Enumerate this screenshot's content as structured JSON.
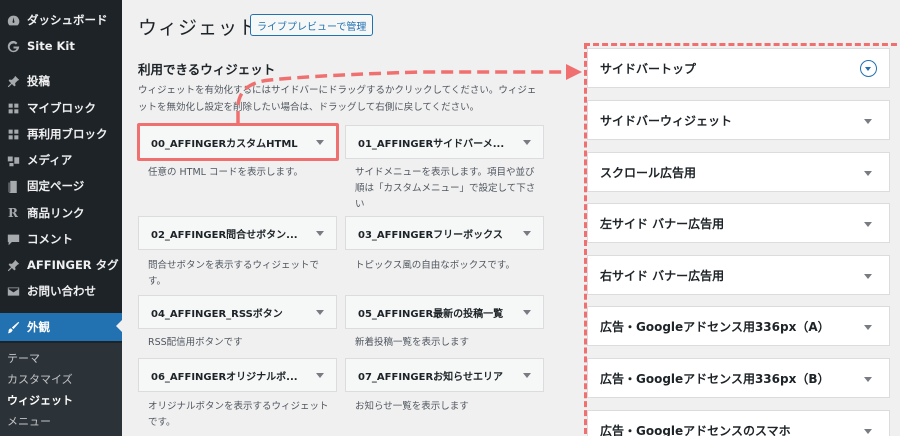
{
  "sidebar": {
    "items": [
      {
        "label": "ダッシュボード",
        "icon": "dashboard-icon"
      },
      {
        "label": "Site Kit",
        "icon": "site-kit-icon"
      },
      {
        "label": "投稿",
        "icon": "pin-icon"
      },
      {
        "label": "マイブロック",
        "icon": "blocks-icon"
      },
      {
        "label": "再利用ブロック",
        "icon": "blocks-icon"
      },
      {
        "label": "メディア",
        "icon": "media-icon"
      },
      {
        "label": "固定ページ",
        "icon": "page-icon"
      },
      {
        "label": "商品リンク",
        "icon": "r-icon"
      },
      {
        "label": "コメント",
        "icon": "comment-icon"
      },
      {
        "label": "AFFINGER タグ",
        "icon": "pin-icon"
      },
      {
        "label": "お問い合わせ",
        "icon": "mail-icon"
      },
      {
        "label": "外観",
        "icon": "brush-icon"
      }
    ],
    "submenu": [
      "テーマ",
      "カスタマイズ",
      "ウィジェット",
      "メニュー"
    ]
  },
  "header": {
    "title": "ウィジェット",
    "preview_button": "ライブプレビューで管理"
  },
  "available": {
    "title": "利用できるウィジェット",
    "desc_line1": "ウィジェットを有効化するにはサイドバーにドラッグするかクリックしてください。ウィジェ",
    "desc_line2": "ットを無効化し設定を削除したい場合は、ドラッグして右側に戻してください。"
  },
  "widgets": [
    {
      "name": "00_AFFINGERカスタムHTML",
      "desc": [
        "任意の HTML コードを表示します。"
      ]
    },
    {
      "name": "01_AFFINGERサイドバーメ...",
      "desc": [
        "サイドメニューを表示します。項目や並び",
        "順は「カスタムメニュー」で設定して下さ",
        "い"
      ]
    },
    {
      "name": "02_AFFINGER問合せボタン...",
      "desc": [
        "問合せボタンを表示するウィジェットで",
        "す。"
      ]
    },
    {
      "name": "03_AFFINGERフリーボックス",
      "desc": [
        "トピックス風の自由なボックスです。"
      ]
    },
    {
      "name": "04_AFFINGER_RSSボタン",
      "desc": [
        "RSS配信用ボタンです"
      ]
    },
    {
      "name": "05_AFFINGER最新の投稿一覧",
      "desc": [
        "新着投稿一覧を表示します"
      ]
    },
    {
      "name": "06_AFFINGERオリジナルボ...",
      "desc": [
        "オリジナルボタンを表示するウィジェット",
        "です。"
      ]
    },
    {
      "name": "07_AFFINGERお知らせエリア",
      "desc": [
        "お知らせ一覧を表示します"
      ]
    }
  ],
  "sidebars": [
    "サイドバートップ",
    "サイドバーウィジェット",
    "スクロール広告用",
    "左サイド バナー広告用",
    "右サイド バナー広告用",
    "広告・Googleアドセンス用336px（A）",
    "広告・Googleアドセンス用336px（B）",
    "広告・Googleアドセンスのスマホ"
  ],
  "colors": {
    "admin_bg": "#1d2327",
    "active_blue": "#2271b1",
    "highlight_red": "#f07070"
  }
}
